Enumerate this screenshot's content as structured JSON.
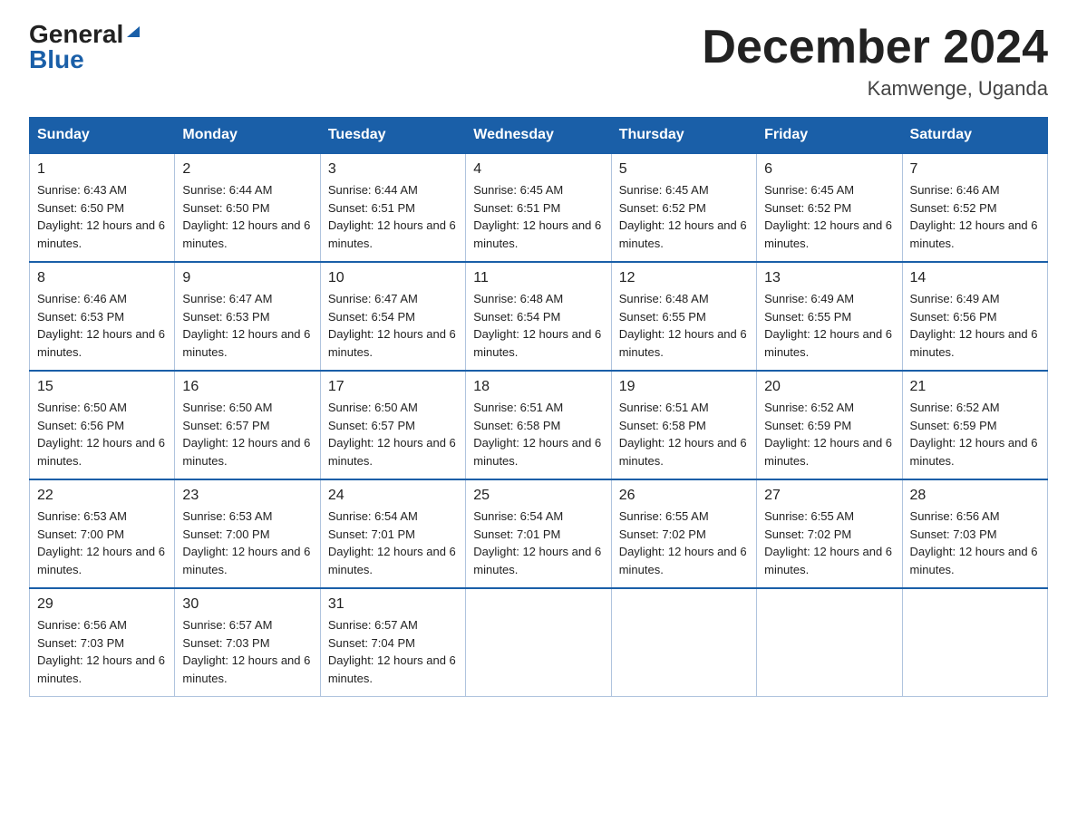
{
  "logo": {
    "general": "General",
    "triangle": "▶",
    "blue": "Blue"
  },
  "title": "December 2024",
  "location": "Kamwenge, Uganda",
  "days_of_week": [
    "Sunday",
    "Monday",
    "Tuesday",
    "Wednesday",
    "Thursday",
    "Friday",
    "Saturday"
  ],
  "weeks": [
    [
      {
        "day": "1",
        "sunrise": "6:43 AM",
        "sunset": "6:50 PM",
        "daylight": "12 hours and 6 minutes."
      },
      {
        "day": "2",
        "sunrise": "6:44 AM",
        "sunset": "6:50 PM",
        "daylight": "12 hours and 6 minutes."
      },
      {
        "day": "3",
        "sunrise": "6:44 AM",
        "sunset": "6:51 PM",
        "daylight": "12 hours and 6 minutes."
      },
      {
        "day": "4",
        "sunrise": "6:45 AM",
        "sunset": "6:51 PM",
        "daylight": "12 hours and 6 minutes."
      },
      {
        "day": "5",
        "sunrise": "6:45 AM",
        "sunset": "6:52 PM",
        "daylight": "12 hours and 6 minutes."
      },
      {
        "day": "6",
        "sunrise": "6:45 AM",
        "sunset": "6:52 PM",
        "daylight": "12 hours and 6 minutes."
      },
      {
        "day": "7",
        "sunrise": "6:46 AM",
        "sunset": "6:52 PM",
        "daylight": "12 hours and 6 minutes."
      }
    ],
    [
      {
        "day": "8",
        "sunrise": "6:46 AM",
        "sunset": "6:53 PM",
        "daylight": "12 hours and 6 minutes."
      },
      {
        "day": "9",
        "sunrise": "6:47 AM",
        "sunset": "6:53 PM",
        "daylight": "12 hours and 6 minutes."
      },
      {
        "day": "10",
        "sunrise": "6:47 AM",
        "sunset": "6:54 PM",
        "daylight": "12 hours and 6 minutes."
      },
      {
        "day": "11",
        "sunrise": "6:48 AM",
        "sunset": "6:54 PM",
        "daylight": "12 hours and 6 minutes."
      },
      {
        "day": "12",
        "sunrise": "6:48 AM",
        "sunset": "6:55 PM",
        "daylight": "12 hours and 6 minutes."
      },
      {
        "day": "13",
        "sunrise": "6:49 AM",
        "sunset": "6:55 PM",
        "daylight": "12 hours and 6 minutes."
      },
      {
        "day": "14",
        "sunrise": "6:49 AM",
        "sunset": "6:56 PM",
        "daylight": "12 hours and 6 minutes."
      }
    ],
    [
      {
        "day": "15",
        "sunrise": "6:50 AM",
        "sunset": "6:56 PM",
        "daylight": "12 hours and 6 minutes."
      },
      {
        "day": "16",
        "sunrise": "6:50 AM",
        "sunset": "6:57 PM",
        "daylight": "12 hours and 6 minutes."
      },
      {
        "day": "17",
        "sunrise": "6:50 AM",
        "sunset": "6:57 PM",
        "daylight": "12 hours and 6 minutes."
      },
      {
        "day": "18",
        "sunrise": "6:51 AM",
        "sunset": "6:58 PM",
        "daylight": "12 hours and 6 minutes."
      },
      {
        "day": "19",
        "sunrise": "6:51 AM",
        "sunset": "6:58 PM",
        "daylight": "12 hours and 6 minutes."
      },
      {
        "day": "20",
        "sunrise": "6:52 AM",
        "sunset": "6:59 PM",
        "daylight": "12 hours and 6 minutes."
      },
      {
        "day": "21",
        "sunrise": "6:52 AM",
        "sunset": "6:59 PM",
        "daylight": "12 hours and 6 minutes."
      }
    ],
    [
      {
        "day": "22",
        "sunrise": "6:53 AM",
        "sunset": "7:00 PM",
        "daylight": "12 hours and 6 minutes."
      },
      {
        "day": "23",
        "sunrise": "6:53 AM",
        "sunset": "7:00 PM",
        "daylight": "12 hours and 6 minutes."
      },
      {
        "day": "24",
        "sunrise": "6:54 AM",
        "sunset": "7:01 PM",
        "daylight": "12 hours and 6 minutes."
      },
      {
        "day": "25",
        "sunrise": "6:54 AM",
        "sunset": "7:01 PM",
        "daylight": "12 hours and 6 minutes."
      },
      {
        "day": "26",
        "sunrise": "6:55 AM",
        "sunset": "7:02 PM",
        "daylight": "12 hours and 6 minutes."
      },
      {
        "day": "27",
        "sunrise": "6:55 AM",
        "sunset": "7:02 PM",
        "daylight": "12 hours and 6 minutes."
      },
      {
        "day": "28",
        "sunrise": "6:56 AM",
        "sunset": "7:03 PM",
        "daylight": "12 hours and 6 minutes."
      }
    ],
    [
      {
        "day": "29",
        "sunrise": "6:56 AM",
        "sunset": "7:03 PM",
        "daylight": "12 hours and 6 minutes."
      },
      {
        "day": "30",
        "sunrise": "6:57 AM",
        "sunset": "7:03 PM",
        "daylight": "12 hours and 6 minutes."
      },
      {
        "day": "31",
        "sunrise": "6:57 AM",
        "sunset": "7:04 PM",
        "daylight": "12 hours and 6 minutes."
      },
      null,
      null,
      null,
      null
    ]
  ]
}
